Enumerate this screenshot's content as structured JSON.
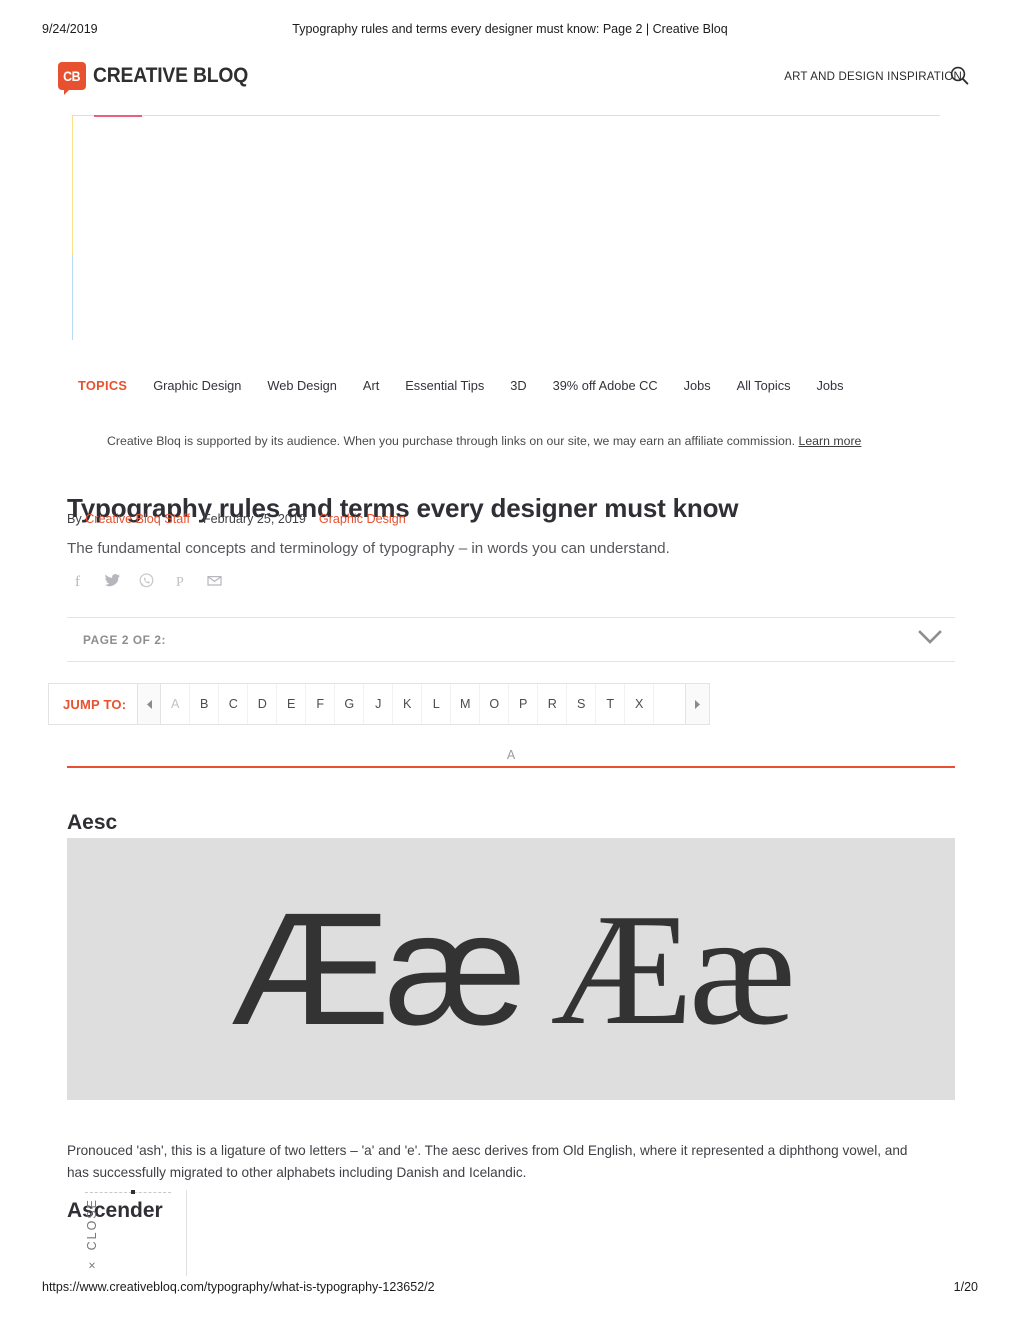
{
  "print": {
    "date": "9/24/2019",
    "doc_title": "Typography rules and terms every designer must know: Page 2 | Creative Bloq",
    "url": "https://www.creativebloq.com/typography/what-is-typography-123652/2",
    "page_number": "1/20"
  },
  "header": {
    "logo_badge": "CB",
    "logo_text": "CREATIVE BLOQ",
    "tagline": "ART AND DESIGN INSPIRATION",
    "search_icon": "search-icon"
  },
  "topics": {
    "label": "TOPICS",
    "items": [
      {
        "label": "Graphic Design"
      },
      {
        "label": "Web Design"
      },
      {
        "label": "Art"
      },
      {
        "label": "Essential Tips"
      },
      {
        "label": "3D"
      },
      {
        "label": "39% off Adobe CC"
      },
      {
        "label": "Jobs"
      },
      {
        "label": "All Topics"
      },
      {
        "label": "Jobs"
      }
    ]
  },
  "affiliate": {
    "text": "Creative Bloq is supported by its audience. When you purchase through links on our site, we may earn an affiliate commission.",
    "link_label": "Learn more"
  },
  "article": {
    "title": "Typography rules and terms every designer must know",
    "by_prefix": "By",
    "author": "Creative Bloq Staff",
    "date": "February 25, 2019",
    "category": "Graphic Design",
    "standfirst": "The fundamental concepts and terminology of typography – in words you can understand.",
    "share_icons": [
      "facebook-icon",
      "twitter-icon",
      "whatsapp-icon",
      "pinterest-icon",
      "email-icon"
    ]
  },
  "page_selector": {
    "label": "PAGE 2 OF 2:",
    "toggle_icon": "chevron-down-icon"
  },
  "jump_to": {
    "label": "JUMP TO:",
    "prev_icon": "caret-left-icon",
    "next_icon": "caret-right-icon",
    "letters": [
      {
        "label": "A",
        "state": "dim"
      },
      {
        "label": "B",
        "state": "normal"
      },
      {
        "label": "C",
        "state": "normal"
      },
      {
        "label": "D",
        "state": "normal"
      },
      {
        "label": "E",
        "state": "normal"
      },
      {
        "label": "F",
        "state": "normal"
      },
      {
        "label": "G",
        "state": "normal"
      },
      {
        "label": "J",
        "state": "normal"
      },
      {
        "label": "K",
        "state": "normal"
      },
      {
        "label": "L",
        "state": "normal"
      },
      {
        "label": "M",
        "state": "normal"
      },
      {
        "label": "O",
        "state": "normal"
      },
      {
        "label": "P",
        "state": "normal"
      },
      {
        "label": "R",
        "state": "normal"
      },
      {
        "label": "S",
        "state": "normal"
      },
      {
        "label": "T",
        "state": "normal"
      },
      {
        "label": "X",
        "state": "normal"
      }
    ]
  },
  "section": {
    "letter": "A",
    "term": "Aesc",
    "figure_sans": "Ææ",
    "figure_serif": "Ææ",
    "body": "Pronouced 'ash', this is a ligature of two letters – 'a' and 'e'. The aesc derives from Old English, where it represented a diphthong vowel, and has successfully migrated to other alphabets including Danish and Icelandic.",
    "next_term": "Ascender"
  },
  "close_overlay": {
    "label": "CLOSE",
    "close_icon": "close-x-icon"
  },
  "colors": {
    "brand_orange": "#e8512f",
    "figure_bg": "#dedede",
    "text_dark": "#2f2f35"
  }
}
